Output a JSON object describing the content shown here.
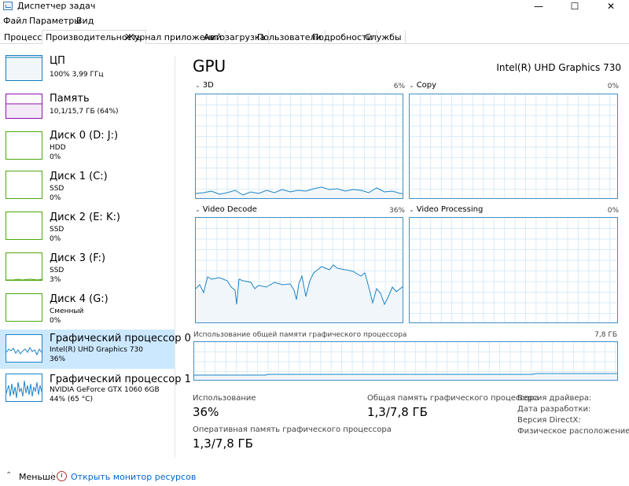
{
  "window": {
    "title": "Диспетчер задач",
    "minimize_glyph": "—",
    "maximize_glyph": "☐",
    "close_glyph": "✕"
  },
  "menu": [
    "Файл",
    "Параметры",
    "Вид"
  ],
  "tabs": [
    {
      "label": "Процессы",
      "active": false
    },
    {
      "label": "Производительность",
      "active": true
    },
    {
      "label": "Журнал приложений",
      "active": false
    },
    {
      "label": "Автозагрузка",
      "active": false
    },
    {
      "label": "Пользователи",
      "active": false
    },
    {
      "label": "Подробности",
      "active": false
    },
    {
      "label": "Службы",
      "active": false
    }
  ],
  "sidebar": {
    "items": [
      {
        "name": "ЦП",
        "line1": "100% 3,99 ГГц",
        "line2": "",
        "color": "#117dbb",
        "selected": false
      },
      {
        "name": "Память",
        "line1": "10,1/15,7 ГБ (64%)",
        "line2": "",
        "color": "#8b12ae",
        "selected": false
      },
      {
        "name": "Диск 0 (D: J:)",
        "line1": "HDD",
        "line2": "0%",
        "color": "#4da60c",
        "selected": false
      },
      {
        "name": "Диск 1 (C:)",
        "line1": "SSD",
        "line2": "0%",
        "color": "#4da60c",
        "selected": false
      },
      {
        "name": "Диск 2 (E: K:)",
        "line1": "SSD",
        "line2": "0%",
        "color": "#4da60c",
        "selected": false
      },
      {
        "name": "Диск 3 (F:)",
        "line1": "SSD",
        "line2": "3%",
        "color": "#4da60c",
        "selected": false
      },
      {
        "name": "Диск 4 (G:)",
        "line1": "Сменный",
        "line2": "0%",
        "color": "#4da60c",
        "selected": false
      },
      {
        "name": "Графический процессор 0",
        "line1": "Intel(R) UHD Graphics 730",
        "line2": "36%",
        "color": "#1a84c7",
        "selected": true
      },
      {
        "name": "Графический процессор 1",
        "line1": "NVIDIA GeForce GTX 1060 6GB",
        "line2": "44% (65 °C)",
        "color": "#1a84c7",
        "selected": false
      }
    ]
  },
  "main": {
    "title": "GPU",
    "model": "Intel(R) UHD Graphics 730",
    "engines": [
      {
        "label": "3D",
        "pct": "6%"
      },
      {
        "label": "Copy",
        "pct": "0%"
      },
      {
        "label": "Video Decode",
        "pct": "36%"
      },
      {
        "label": "Video Processing",
        "pct": "0%"
      }
    ],
    "shared_memory": {
      "label": "Использование общей памяти графического процессора",
      "max": "7,8 ГБ"
    },
    "stats": {
      "usage_label": "Использование",
      "usage_value": "36%",
      "shared_label": "Общая память графического процессора",
      "shared_value": "1,3/7,8 ГБ",
      "gpu_mem_label": "Оперативная память графического процессора",
      "gpu_mem_value": "1,3/7,8 ГБ"
    },
    "info": [
      "Версия драйвера:",
      "Дата разработки:",
      "Версия DirectX:",
      "Физическое расположение:"
    ]
  },
  "bottom": {
    "less_label": "Меньше",
    "monitor_link": "Открыть монитор ресурсов"
  },
  "colors": {
    "graph_border": "#3f8fc7",
    "graph_grid": "#d9ebf7",
    "graph_fill": "#f1f6fa",
    "selected_bg": "#cce8ff",
    "link": "#0066cc"
  }
}
